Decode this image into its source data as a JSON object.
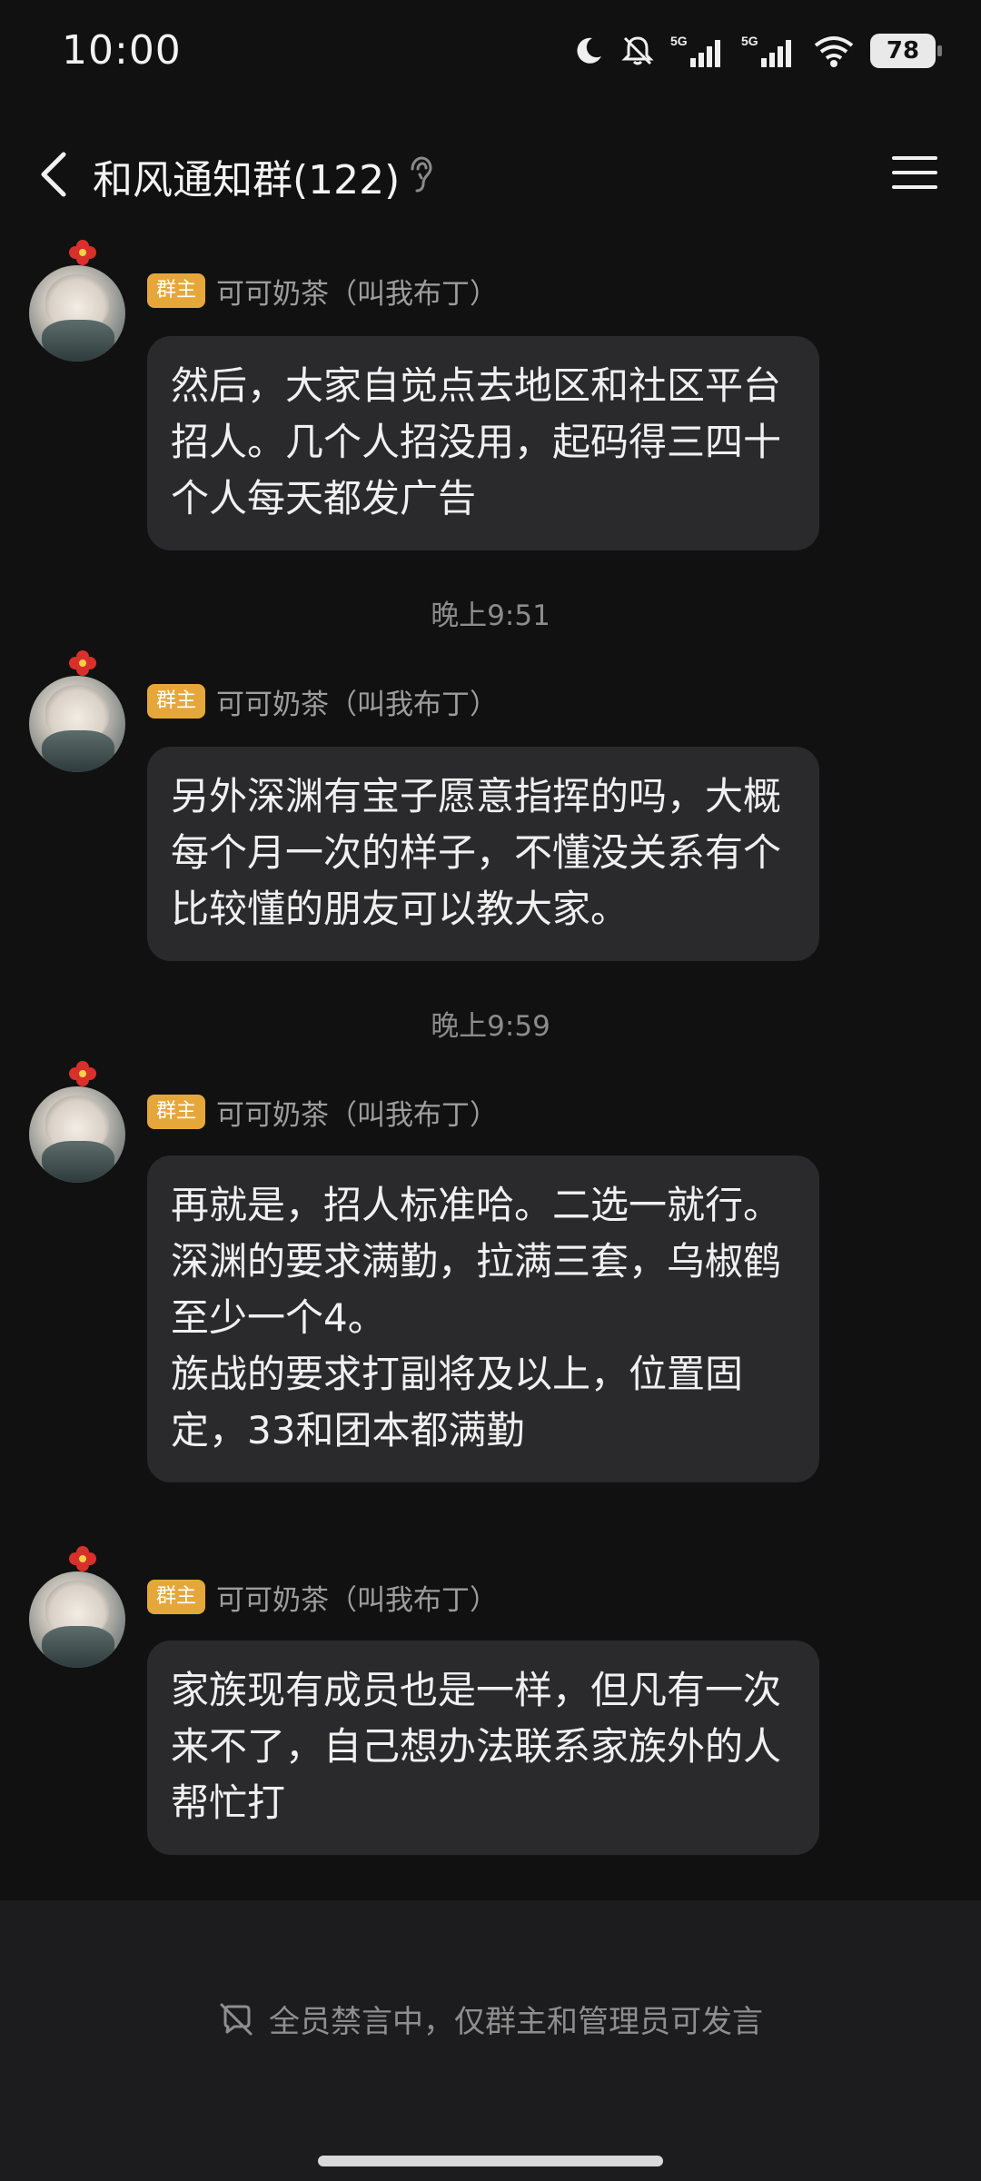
{
  "status_bar": {
    "time": "10:00",
    "icons": [
      "moon-icon",
      "muted-bell-icon",
      "5g-signal-icon",
      "5g-signal-icon",
      "wifi-icon"
    ],
    "battery": "78"
  },
  "header": {
    "title": "和风通知群(122)",
    "icons": [
      "back-arrow-icon",
      "ear-icon",
      "menu-icon"
    ]
  },
  "messages": [
    {
      "badge": "群主",
      "sender": "可可奶茶（叫我布丁）",
      "text": "然后，大家自觉点去地区和社区平台招人。几个人招没用，起码得三四十个人每天都发广告"
    },
    {
      "badge": "群主",
      "sender": "可可奶茶（叫我布丁）",
      "text": "另外深渊有宝子愿意指挥的吗，大概每个月一次的样子，不懂没关系有个比较懂的朋友可以教大家。"
    },
    {
      "badge": "群主",
      "sender": "可可奶茶（叫我布丁）",
      "text": "再就是，招人标准哈。二选一就行。\n深渊的要求满勤，拉满三套，乌椒鹤至少一个4。\n族战的要求打副将及以上，位置固定，33和团本都满勤"
    },
    {
      "badge": "群主",
      "sender": "可可奶茶（叫我布丁）",
      "text": "家族现有成员也是一样，但凡有一次来不了，自己想办法联系家族外的人帮忙打"
    }
  ],
  "timestamps": [
    "晚上9:51",
    "晚上9:59"
  ],
  "footer": {
    "mute_notice": "全员禁言中，仅群主和管理员可发言",
    "icon": "no-speaking-icon"
  },
  "colors": {
    "background": "#111111",
    "bubble": "#2a2a2c",
    "badge": "#e6a73a",
    "muted_text": "#8e8e8e"
  }
}
